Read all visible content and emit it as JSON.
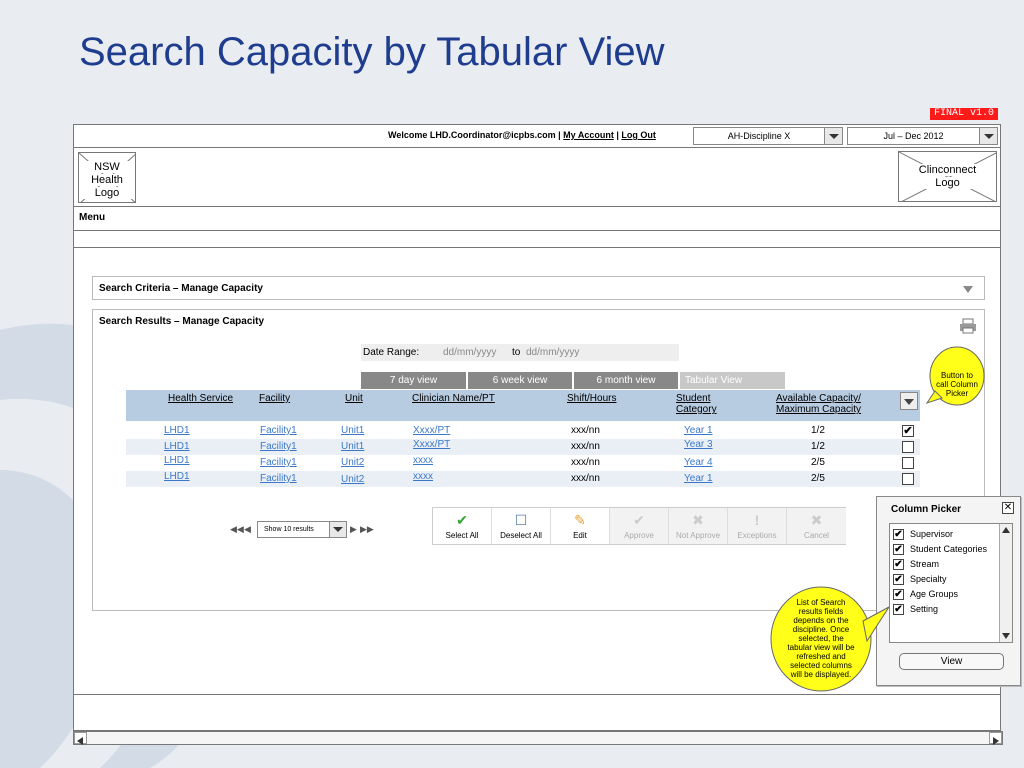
{
  "slide": {
    "title": "Search Capacity by Tabular View",
    "version": "FINAL v1.0"
  },
  "header": {
    "welcome_prefix": "Welcome LHD.Coordinator@icpbs.com |",
    "my_account": "My Account",
    "separator": "|",
    "log_out": "Log Out",
    "discipline_select": "AH-Discipline X",
    "period_select": "Jul – Dec 2012",
    "left_logo_line1": "NSW",
    "left_logo_line2": "Health",
    "left_logo_line3": "Logo",
    "right_logo_line1": "Clinconnect",
    "right_logo_line2": "Logo"
  },
  "menu": {
    "label": "Menu"
  },
  "search_criteria": {
    "title": "Search Criteria – Manage Capacity"
  },
  "search_results": {
    "title": "Search Results – Manage Capacity",
    "date_range_label": "Date Range:",
    "date_from_placeholder": "dd/mm/yyyy",
    "date_to_label": "to",
    "date_to_placeholder": "dd/mm/yyyy",
    "tabs": [
      "7 day view",
      "6 week view",
      "6 month view",
      "Tabular View"
    ],
    "columns": [
      "Health Service",
      "Facility",
      "Unit",
      "Clinician Name/PT",
      "Shift/Hours",
      "Student",
      "Category",
      "Available Capacity/",
      "Maximum Capacity"
    ],
    "rows": [
      {
        "health_service": "LHD1",
        "facility": "Facility1",
        "unit": "Unit1",
        "clinician": "Xxxx/PT",
        "shift": "xxx/nn",
        "student_category": "Year 1",
        "capacity": "1/2",
        "checked": "✔"
      },
      {
        "health_service": "LHD1",
        "facility": "Facility1",
        "unit": "Unit1",
        "clinician": "Xxxx/PT",
        "shift": "xxx/nn",
        "student_category": "Year 3",
        "capacity": "1/2",
        "checked": ""
      },
      {
        "health_service": "LHD1",
        "facility": "Facility1",
        "unit": "Unit2",
        "clinician": "xxxx",
        "shift": "xxx/nn",
        "student_category": "Year 4",
        "capacity": "2/5",
        "checked": ""
      },
      {
        "health_service": "LHD1",
        "facility": "Facility1",
        "unit": "Unit2",
        "clinician": "xxxx",
        "shift": "xxx/nn",
        "student_category": "Year 1",
        "capacity": "2/5",
        "checked": ""
      }
    ],
    "pager": {
      "first": "◀◀",
      "prev": "◀",
      "page_size": "Show 10 results",
      "next": "▶",
      "last": "▶▶"
    },
    "toolbar": [
      {
        "label": "Select All",
        "icon": "✔"
      },
      {
        "label": "Deselect All",
        "icon": "☐"
      },
      {
        "label": "Edit",
        "icon": "✎"
      },
      {
        "label": "Approve",
        "icon": "✔"
      },
      {
        "label": "Not Approve",
        "icon": "✖"
      },
      {
        "label": "Exceptions",
        "icon": "!"
      },
      {
        "label": "Cancel",
        "icon": "✖"
      }
    ]
  },
  "column_picker": {
    "title": "Column Picker",
    "close": "✕",
    "items": [
      "Supervisor",
      "Student Categories",
      "Stream",
      "Specialty",
      "Age Groups",
      "Setting"
    ],
    "check": "✔",
    "view_button": "View"
  },
  "annotations": {
    "picker_button_note": [
      "Button to",
      "call Column",
      "Picker"
    ],
    "list_note": [
      "List of Search",
      "results fields",
      "depends on the",
      "discipline. Once",
      "selected, the",
      "tabular view will be",
      "refreshed and",
      "selected columns",
      "will be displayed."
    ]
  },
  "colors": {
    "title_blue": "#1f3d8f",
    "header_blue": "#b7cbe1",
    "link_blue": "#3b78c8",
    "note_yellow": "#ffff1a",
    "version_red": "#ff1a1a"
  }
}
